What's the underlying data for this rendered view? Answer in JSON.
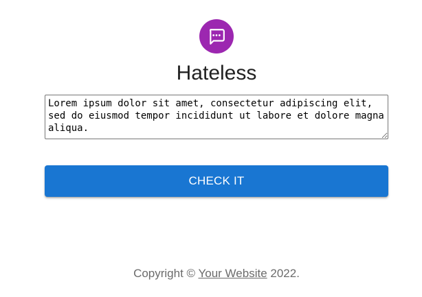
{
  "header": {
    "logo_icon": "chat-bubble-icon",
    "logo_color": "#9c27b0",
    "title": "Hateless"
  },
  "form": {
    "text_value": "Lorem ipsum dolor sit amet, consectetur adipiscing elit, sed do eiusmod tempor incididunt ut labore et dolore magna aliqua.",
    "button_label": "CHECK IT",
    "button_color": "#1976d2"
  },
  "footer": {
    "prefix": "Copyright © ",
    "link_text": "Your Website",
    "suffix": " 2022."
  }
}
